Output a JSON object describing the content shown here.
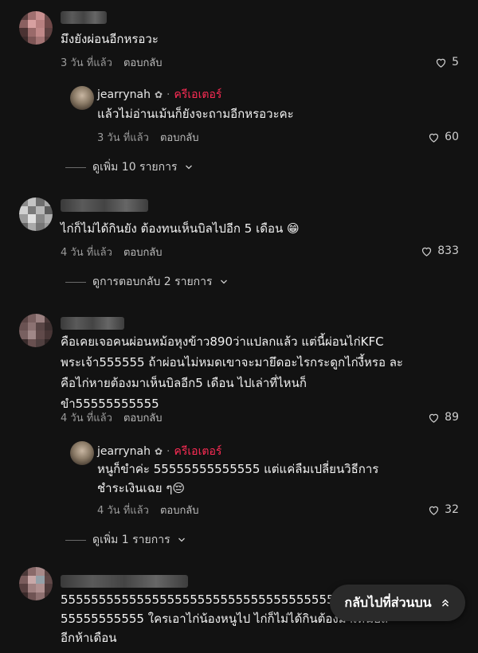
{
  "comments": [
    {
      "text": [
        "มึงยังผ่อนอีกหรอวะ"
      ],
      "time": "3 วัน ที่แล้ว",
      "reply_label": "ตอบกลับ",
      "likes": "5",
      "reply": {
        "username": "jearrynah",
        "badge": "ครีเอเตอร์",
        "text": [
          "แล้วไม่อ่านเม้นก็ยังจะถามอีกหรอวะคะ"
        ],
        "time": "3 วัน ที่แล้ว",
        "reply_label": "ตอบกลับ",
        "likes": "60"
      },
      "more": "ดูเพิ่ม 10 รายการ"
    },
    {
      "text": [
        "ไก่ก็ไม่ได้กินยัง ต้องทนเห็นบิลไปอีก 5 เดือน 😁"
      ],
      "time": "4 วัน ที่แล้ว",
      "reply_label": "ตอบกลับ",
      "likes": "833",
      "more": "ดูการตอบกลับ 2 รายการ"
    },
    {
      "text": [
        "คือเคยเจอคนผ่อนหม้อหุงข้าว890ว่าแปลกแล้ว แต่นี้ผ่อนไก่KFC",
        "พระเจ้า555555 ถ้าผ่อนไม่หมดเขาจะมายึดอะไรกระดูกไก่งี้หรอ ละ",
        "คือไก่หายต้องมาเห็นบิลอีก5 เดือน ไปเล่าที่ไหนก็",
        "ขำ55555555555"
      ],
      "time": "4 วัน ที่แล้ว",
      "reply_label": "ตอบกลับ",
      "likes": "89",
      "reply": {
        "username": "jearrynah",
        "badge": "ครีเอเตอร์",
        "text": [
          "หนูก็ขำค่ะ 55555555555555 แต่แค่ลืมเปลี่ยนวิธีการ",
          "ชำระเงินเฉย ๆ😔"
        ],
        "time": "4 วัน ที่แล้ว",
        "reply_label": "ตอบกลับ",
        "likes": "32"
      },
      "more": "ดูเพิ่ม 1 รายการ"
    },
    {
      "text": [
        "5555555555555555555555555555555555555",
        "55555555555 ใครเอาไก่น้องหนูไป ไก่ก็ไม่ได้กินต้องมาเห็นบิล",
        "อีกห้าเดือน"
      ]
    }
  ],
  "back_to_top": "กลับไปที่ส่วนบน"
}
